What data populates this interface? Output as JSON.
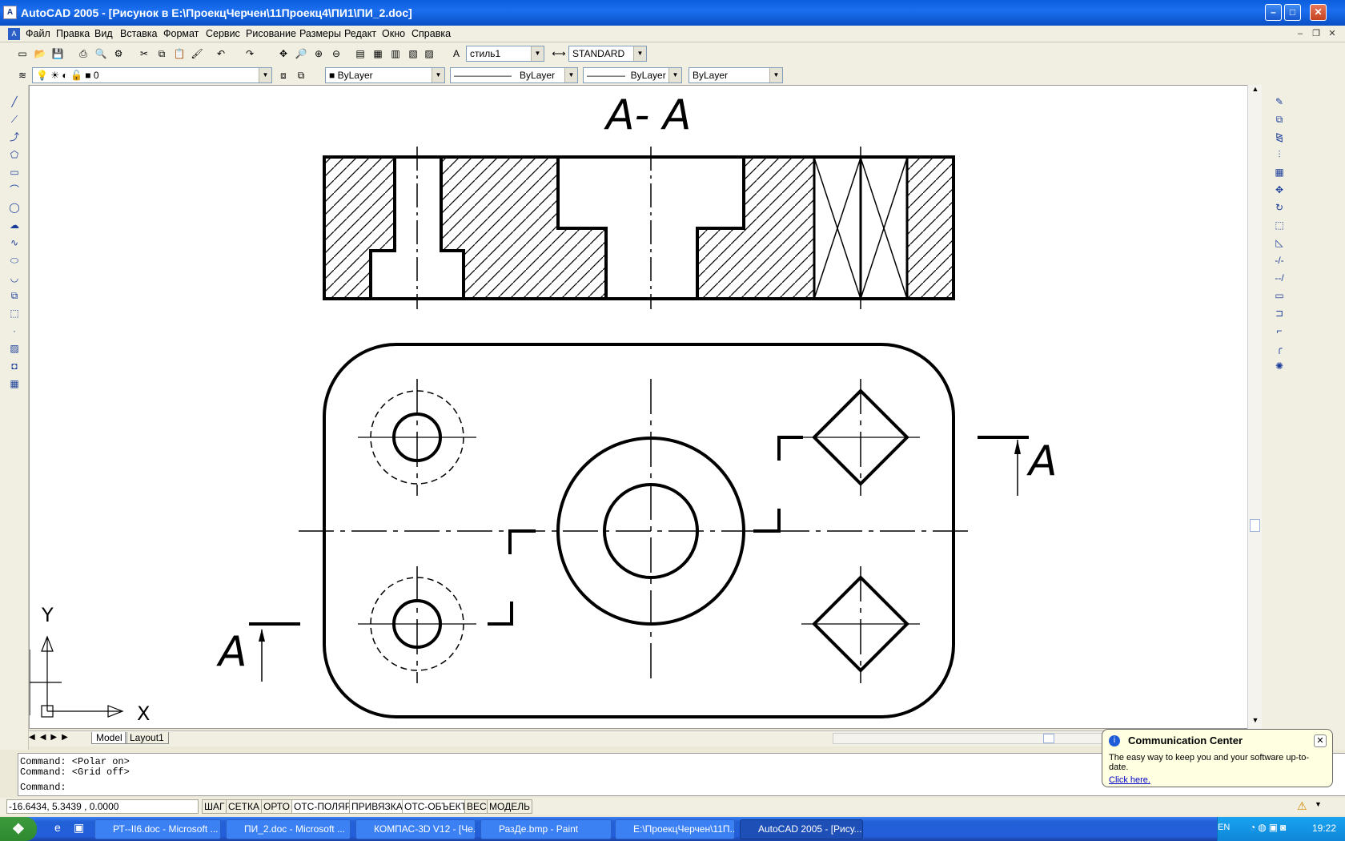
{
  "window": {
    "title": "AutoCAD 2005 - [Рисунок в E:\\ПроекцЧерчен\\11Проекц4\\ПИ1\\ПИ_2.doc]",
    "min": "–",
    "max": "□",
    "close": "✕"
  },
  "menu": [
    "Файл",
    "Правка",
    "Вид",
    "Вставка",
    "Формат",
    "Сервис",
    "Рисование",
    "Размеры",
    "Редакт",
    "Окно",
    "Справка"
  ],
  "toolbar": {
    "text_style": "стиль1",
    "dim_style": "STANDARD",
    "layer": "0",
    "color": "ByLayer",
    "linetype": "ByLayer",
    "lineweight": "ByLayer",
    "plotstyle": "ByLayer"
  },
  "drawing": {
    "section_title": "A- A",
    "cut_label_left": "A",
    "cut_label_right": "A",
    "ucs_x": "X",
    "ucs_y": "Y"
  },
  "tabs": {
    "model": "Model",
    "layout": "Layout1"
  },
  "command": {
    "line1": "Command:  <Polar on>",
    "line2": "Command:  <Grid off>",
    "prompt": "Command:"
  },
  "status": {
    "coords": "-16.6434, 5.3439 , 0.0000",
    "buttons": [
      "ШАГ",
      "СЕТКА",
      "ОРТО",
      "ОТС-ПОЛЯР",
      "ПРИВЯЗКА",
      "ОТС-ОБЪЕКТ",
      "ВЕС",
      "МОДЕЛЬ"
    ]
  },
  "balloon": {
    "title": "Communication Center",
    "text": "The easy way to keep you and your software up-to-date.",
    "link": "Click here."
  },
  "taskbar": {
    "tasks": [
      "РТ--II6.doc - Microsoft ...",
      "ПИ_2.doc - Microsoft ...",
      "КОМПАС-3D V12 - [Че...",
      "РазДе.bmp - Paint",
      "E:\\ПроекцЧерчен\\11П...",
      "AutoCAD 2005 - [Рису..."
    ],
    "lang": "EN",
    "clock": "19:22"
  }
}
